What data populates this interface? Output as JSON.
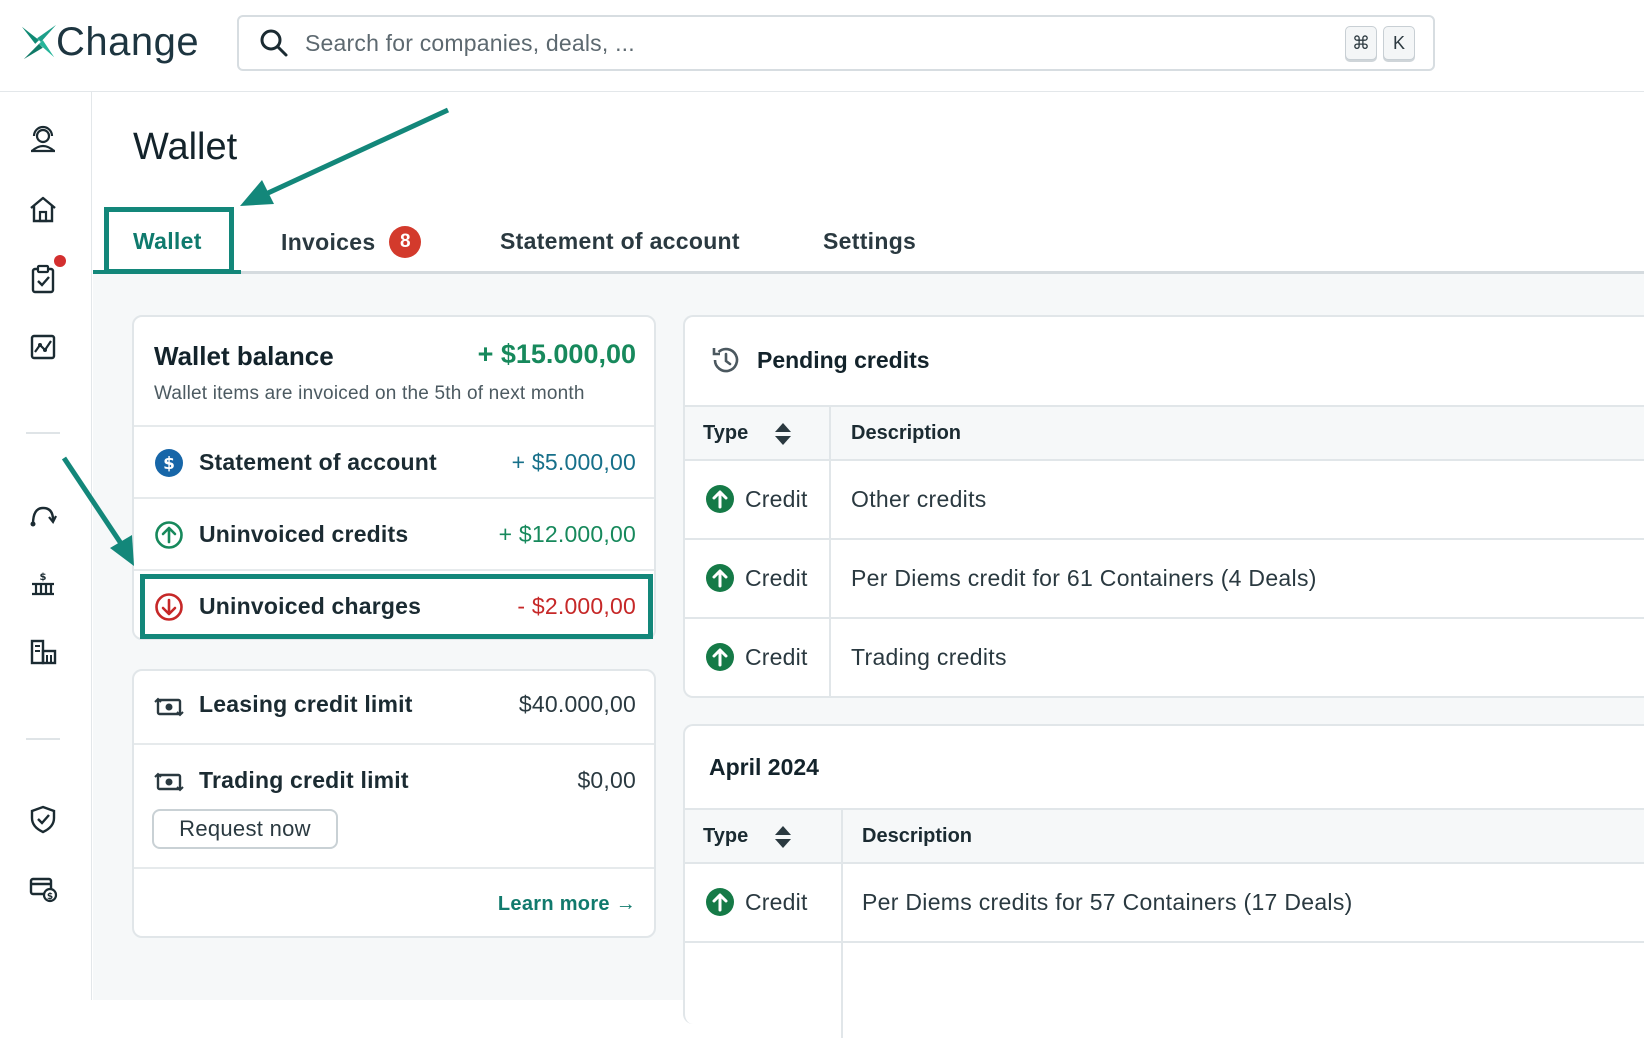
{
  "app": {
    "logo_text": "Change",
    "search_placeholder": "Search for companies, deals, ...",
    "shortcut_keys": [
      "⌘",
      "K"
    ]
  },
  "sidebar": {
    "icons": [
      "support-agent-icon",
      "home-icon",
      "clipboard-check-icon",
      "analytics-icon",
      "route-icon",
      "depot-money-icon",
      "warehouse-icon",
      "shield-check-icon",
      "payment-card-icon"
    ]
  },
  "page": {
    "title": "Wallet",
    "tabs": [
      {
        "label": "Wallet",
        "active": true
      },
      {
        "label": "Invoices",
        "badge": "8"
      },
      {
        "label": "Statement of account"
      },
      {
        "label": "Settings"
      }
    ]
  },
  "wallet_balance": {
    "title": "Wallet balance",
    "amount": "+ $15.000,00",
    "subtitle": "Wallet items are invoiced on the 5th of next month",
    "rows": [
      {
        "label": "Statement of account",
        "value": "+ $5.000,00",
        "icon": "dollar-circle-icon"
      },
      {
        "label": "Uninvoiced credits",
        "value": "+ $12.000,00",
        "icon": "arrow-up-circle-icon"
      },
      {
        "label": "Uninvoiced charges",
        "value": "- $2.000,00",
        "icon": "arrow-down-circle-icon"
      }
    ]
  },
  "credit_limits": {
    "rows": [
      {
        "label": "Leasing credit limit",
        "value": "$40.000,00",
        "icon": "money-exchange-icon"
      },
      {
        "label": "Trading credit limit",
        "value": "$0,00",
        "icon": "money-exchange-icon"
      }
    ],
    "request_button": "Request now",
    "learn_more": "Learn more →"
  },
  "pending_credits": {
    "title": "Pending credits",
    "columns": [
      "Type",
      "Description"
    ],
    "rows": [
      {
        "type": "Credit",
        "description": "Other credits"
      },
      {
        "type": "Credit",
        "description": "Per Diems credit for 61 Containers (4 Deals)"
      },
      {
        "type": "Credit",
        "description": "Trading credits"
      }
    ]
  },
  "april": {
    "title": "April 2024",
    "columns": [
      "Type",
      "Description"
    ],
    "rows": [
      {
        "type": "Credit",
        "description": "Per Diems credits for 57 Containers (17 Deals)"
      }
    ]
  },
  "colors": {
    "accent": "#13877a",
    "positive": "#17895c",
    "negative": "#c62828",
    "badge": "#d33a2c"
  }
}
